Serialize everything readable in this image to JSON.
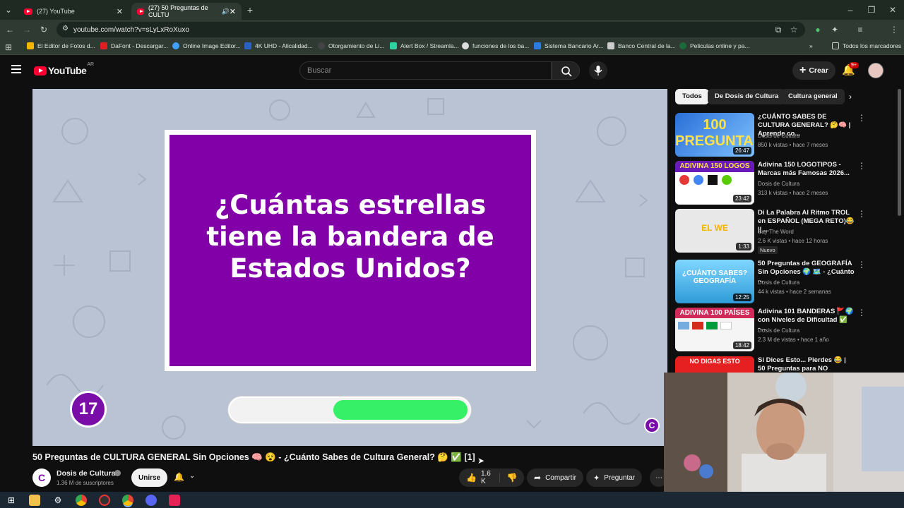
{
  "browser": {
    "tabs": [
      {
        "label": "(27) YouTube"
      },
      {
        "label": "(27) 50 Preguntas de CULTU"
      }
    ],
    "url": "youtube.com/watch?v=sLyLxRoXuxo",
    "bookmarks": [
      "El Editor de Fotos d...",
      "DaFont - Descargar...",
      "Online Image Editor...",
      "4K UHD - Alicalidad...",
      "Otorgamiento de Li...",
      "Alert Box / Streamla...",
      "funciones de los ba...",
      "Sistema Bancario Ar...",
      "Banco Central de la...",
      "Peliculas online y pa..."
    ],
    "all_bookmarks": "Todos los marcadores"
  },
  "youtube": {
    "logo": "YouTube",
    "region": "AR",
    "search_placeholder": "Buscar",
    "create_label": "Crear",
    "notif_badge": "9+"
  },
  "player": {
    "question": "¿Cuántas estrellas tiene la bandera de Estados Unidos?",
    "question_number": "17",
    "timer_remaining": 0.57
  },
  "video": {
    "title": "50 Preguntas de CULTURA GENERAL Sin Opciones 🧠 😵 - ¿Cuánto Sabes de Cultura General? 🤔 ✅ [1]",
    "channel": "Dosis de Cultura",
    "subscribers": "1.36 M de suscriptores",
    "join_label": "Unirse",
    "likes": "1.6 K",
    "share_label": "Compartir",
    "ask_label": "Preguntar"
  },
  "sidebar": {
    "chips": [
      "Todos",
      "De Dosis de Cultura",
      "Cultura general"
    ],
    "recommendations": [
      {
        "title": "¿CUÁNTO SABES DE CULTURA GENERAL? 🤔🧠 | Aprende co...",
        "channel": "Dosis de Cultura",
        "meta": "850 k vistas • hace 7 meses",
        "duration": "26:47",
        "thumb_text": "100 PREGUNTAS",
        "extra": ""
      },
      {
        "title": "Adivina 150 LOGOTIPOS - Marcas más Famosas 2026...",
        "channel": "Dosis de Cultura",
        "meta": "313 k vistas • hace 2 meses",
        "duration": "23:42",
        "thumb_text": "ADIVINA 150 LOGOS",
        "extra": ""
      },
      {
        "title": "Di La Palabra Al Ritmo TROL en ESPAÑOL (MEGA RETO)😂 || ...",
        "channel": "Say The Word",
        "meta": "2.6 K vistas • hace 12 horas",
        "duration": "1:33",
        "thumb_text": "EL WE",
        "extra": "Nuevo"
      },
      {
        "title": "50 Preguntas de GEOGRAFÍA Sin Opciones 🌍 🗺️ - ¿Cuánto ...",
        "channel": "Dosis de Cultura",
        "meta": "44 k vistas • hace 2 semanas",
        "duration": "12:25",
        "thumb_text": "¿CUÁNTO SABES? GEOGRAFÍA",
        "extra": ""
      },
      {
        "title": "Adivina 101 BANDERAS 🚩🌍 con Niveles de Dificultad ✅ -...",
        "channel": "Dosis de Cultura",
        "meta": "2.3 M de vistas • hace 1 año",
        "duration": "18:42",
        "thumb_text": "ADIVINA 100 PAÍSES",
        "extra": ""
      },
      {
        "title": "Si Dices Esto... Pierdes 😂 | 50 Preguntas para NO Coincidir",
        "channel": "",
        "meta": "",
        "duration": "",
        "thumb_text": "NO DIGAS ESTO",
        "extra": ""
      }
    ]
  }
}
